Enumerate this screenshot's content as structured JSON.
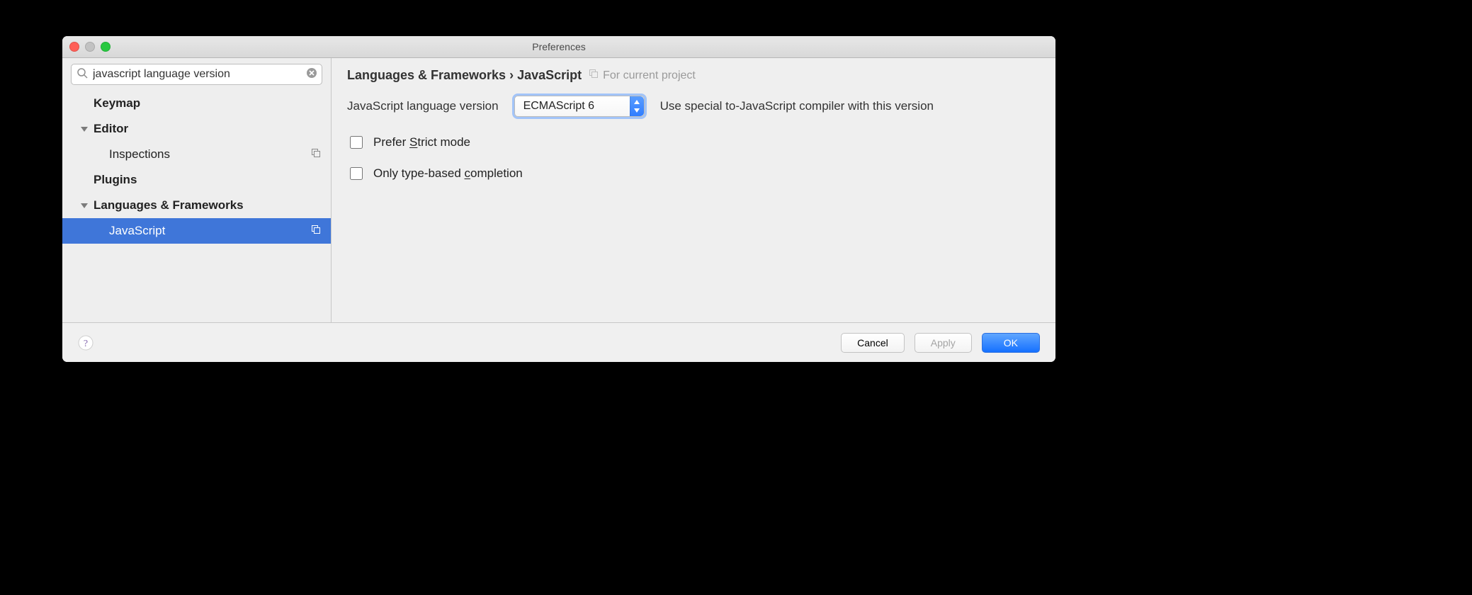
{
  "window": {
    "title": "Preferences"
  },
  "search": {
    "value": "javascript language version"
  },
  "sidebar": {
    "items": [
      {
        "label": "Keymap",
        "level": 0,
        "expandable": false,
        "selected": false,
        "scope_icon": false
      },
      {
        "label": "Editor",
        "level": 0,
        "expandable": true,
        "selected": false,
        "scope_icon": false
      },
      {
        "label": "Inspections",
        "level": 1,
        "expandable": false,
        "selected": false,
        "scope_icon": true
      },
      {
        "label": "Plugins",
        "level": 0,
        "expandable": false,
        "selected": false,
        "scope_icon": false
      },
      {
        "label": "Languages & Frameworks",
        "level": 0,
        "expandable": true,
        "selected": false,
        "scope_icon": false
      },
      {
        "label": "JavaScript",
        "level": 1,
        "expandable": false,
        "selected": true,
        "scope_icon": true
      }
    ]
  },
  "panel": {
    "breadcrumb": "Languages & Frameworks › JavaScript",
    "scope_hint": "For current project",
    "lang_version_label": "JavaScript language version",
    "lang_version_value": "ECMAScript 6",
    "lang_version_note": "Use special to-JavaScript compiler with this version",
    "prefer_strict_label_pre": "Prefer ",
    "prefer_strict_mnemonic": "S",
    "prefer_strict_label_post": "trict mode",
    "prefer_strict_checked": false,
    "completion_label_pre": "Only type-based ",
    "completion_mnemonic": "c",
    "completion_label_post": "ompletion",
    "completion_checked": false
  },
  "footer": {
    "cancel": "Cancel",
    "apply": "Apply",
    "ok": "OK"
  }
}
